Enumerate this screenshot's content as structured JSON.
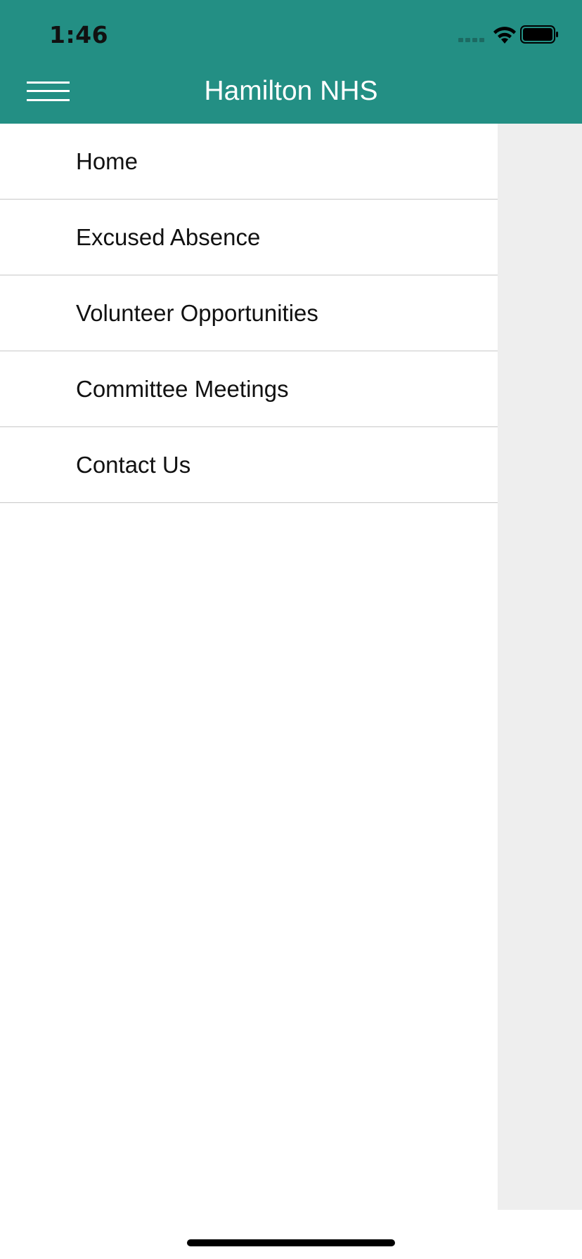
{
  "status_bar": {
    "time": "1:46"
  },
  "header": {
    "title": "Hamilton NHS",
    "background_color": "#238f84"
  },
  "menu": {
    "items": [
      {
        "label": "Home"
      },
      {
        "label": "Excused Absence"
      },
      {
        "label": "Volunteer Opportunities"
      },
      {
        "label": "Committee Meetings"
      },
      {
        "label": "Contact Us"
      }
    ]
  },
  "icons": {
    "menu": "hamburger-menu-icon",
    "wifi": "wifi-icon",
    "battery": "battery-icon",
    "signal": "cellular-signal-icon"
  }
}
